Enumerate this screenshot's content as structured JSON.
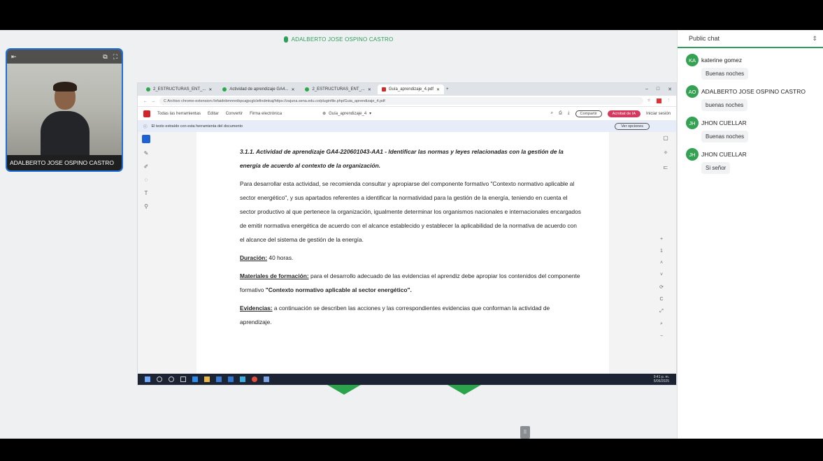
{
  "presenter": {
    "name": "ADALBERTO JOSE OSPINO CASTRO"
  },
  "webcam": {
    "top_left_icon": "⇤",
    "top_right_icons": [
      "⧉",
      "⛶"
    ],
    "name": "ADALBERTO JOSE OSPINO CASTRO"
  },
  "browser": {
    "tabs": [
      {
        "label": "2_ESTRUCTURAS_ENT_...",
        "dot": "green"
      },
      {
        "label": "Actividad de aprendizaje GA4...",
        "dot": "green"
      },
      {
        "label": "2_ESTRUCTURAS_ENT_...",
        "dot": "green"
      },
      {
        "label": "Guía_aprendizaje_4.pdf",
        "dot": "red"
      }
    ],
    "new_tab": "+",
    "window_controls": [
      "–",
      "□",
      "✕"
    ],
    "url": "C  Archivo  chrome-extension://efaidnbmnnnibpcajpcglclefindmkaj/https://zajuna.sena.edu.co/pluginfile.php/Guia_aprendizaje_4.pdf",
    "pdf_toolbar": {
      "items": [
        "Todas las herramientas",
        "Editar",
        "Convertir",
        "Firma electrónica"
      ],
      "file_name": "Guía_aprendizaje_4",
      "share_label": "Compartir",
      "acrobat_label": "Acrobat de IA",
      "signin_label": "Iniciar sesión"
    },
    "notice": {
      "text": "El texto extraído con esta herramienta del documento",
      "button_label": "Ver opciones"
    }
  },
  "document": {
    "heading": "3.1.1.   Actividad de aprendizaje GA4-220601043-AA1 - Identificar las normas y leyes relacionadas con la gestión de la energía de acuerdo al contexto de la organización.",
    "para1": "Para desarrollar esta actividad, se recomienda consultar y apropiarse del componente formativo \"Contexto normativo aplicable al sector energético\", y sus apartados referentes a identificar la normatividad para la gestión de la energía, teniendo en cuenta el sector productivo al que pertenece la organización, igualmente determinar los organismos nacionales e internacionales encargados de emitir normativa energética de acuerdo con el alcance establecido y establecer la aplicabilidad de la normativa de acuerdo con el alcance del sistema de gestión de la energía.",
    "duration_label": "Duración:",
    "duration_value": " 40 horas.",
    "materials_label": "Materiales de formación:",
    "materials_text": " para el desarrollo adecuado de las evidencias el aprendiz debe apropiar los contenidos del componente formativo ",
    "materials_bold": "\"Contexto normativo aplicable al sector energético\".",
    "evidence_label": "Evidencias:",
    "evidence_text": " a continuación se describen las acciones y las correspondientes evidencias que conforman la actividad de aprendizaje."
  },
  "taskbar": {
    "time": "9:41 p. m.",
    "date": "5/06/2025"
  },
  "chat": {
    "title": "Public chat",
    "messages": [
      {
        "initials": "KA",
        "name": "katerine gomez",
        "text": "Buenas noches"
      },
      {
        "initials": "AO",
        "name": "ADALBERTO JOSE OSPINO CASTRO",
        "text": "buenas noches"
      },
      {
        "initials": "JH",
        "name": "JHON CUELLAR",
        "text": "Buenas noches"
      },
      {
        "initials": "JH",
        "name": "JHON CUELLAR",
        "text": "Si señor"
      }
    ]
  },
  "colors": {
    "accent": "#2f9e5a",
    "webcam_border": "#1e6fd9",
    "taskbar": "#1c2433"
  },
  "icons": [
    "microphone-icon",
    "cursor-tool-icon",
    "comment-icon",
    "highlight-icon",
    "zoom-icon",
    "chevron-up-icon",
    "chevron-down-icon"
  ]
}
